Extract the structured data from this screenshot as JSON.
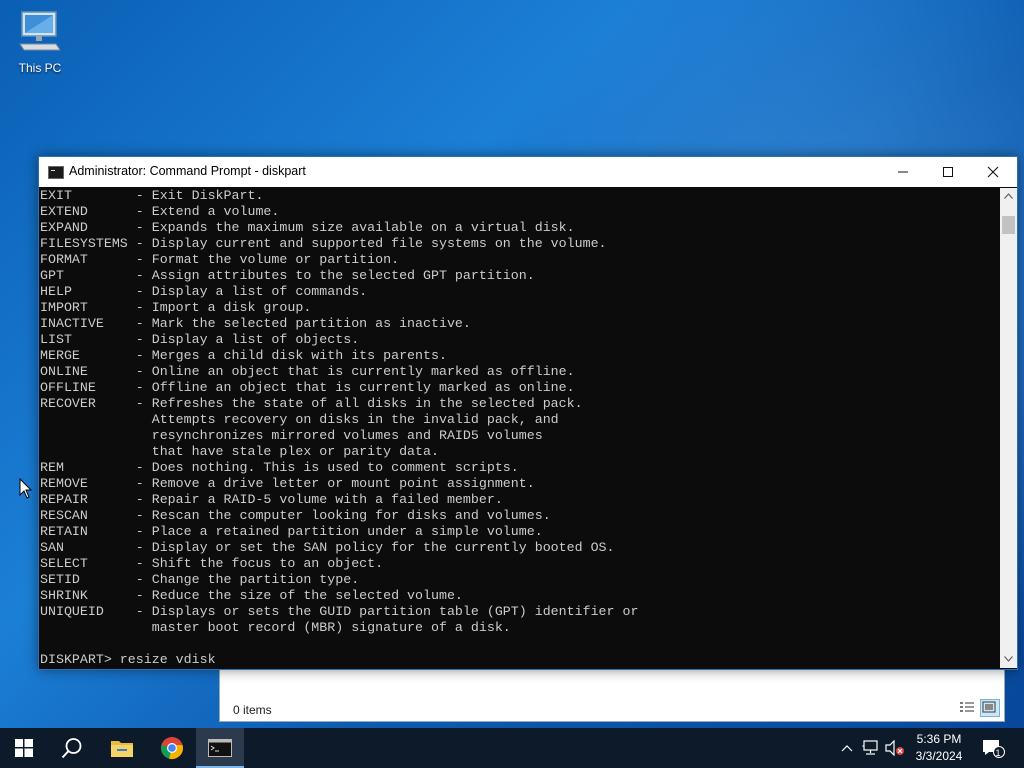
{
  "desktop": {
    "icons": [
      {
        "label": "This PC",
        "icon": "computer-icon"
      }
    ]
  },
  "explorer": {
    "status": "0 items"
  },
  "cmd_window": {
    "title": "Administrator: Command Prompt - diskpart",
    "controls": [
      "minimize",
      "maximize",
      "close"
    ],
    "lines": [
      "EXIT        - Exit DiskPart.",
      "EXTEND      - Extend a volume.",
      "EXPAND      - Expands the maximum size available on a virtual disk.",
      "FILESYSTEMS - Display current and supported file systems on the volume.",
      "FORMAT      - Format the volume or partition.",
      "GPT         - Assign attributes to the selected GPT partition.",
      "HELP        - Display a list of commands.",
      "IMPORT      - Import a disk group.",
      "INACTIVE    - Mark the selected partition as inactive.",
      "LIST        - Display a list of objects.",
      "MERGE       - Merges a child disk with its parents.",
      "ONLINE      - Online an object that is currently marked as offline.",
      "OFFLINE     - Offline an object that is currently marked as online.",
      "RECOVER     - Refreshes the state of all disks in the selected pack.",
      "              Attempts recovery on disks in the invalid pack, and",
      "              resynchronizes mirrored volumes and RAID5 volumes",
      "              that have stale plex or parity data.",
      "REM         - Does nothing. This is used to comment scripts.",
      "REMOVE      - Remove a drive letter or mount point assignment.",
      "REPAIR      - Repair a RAID-5 volume with a failed member.",
      "RESCAN      - Rescan the computer looking for disks and volumes.",
      "RETAIN      - Place a retained partition under a simple volume.",
      "SAN         - Display or set the SAN policy for the currently booted OS.",
      "SELECT      - Shift the focus to an object.",
      "SETID       - Change the partition type.",
      "SHRINK      - Reduce the size of the selected volume.",
      "UNIQUEID    - Displays or sets the GUID partition table (GPT) identifier or",
      "              master boot record (MBR) signature of a disk.",
      "",
      "DISKPART> resize vdisk"
    ]
  },
  "taskbar": {
    "pinned": [
      {
        "name": "start",
        "icon": "windows-logo-icon"
      },
      {
        "name": "search",
        "icon": "search-icon"
      },
      {
        "name": "file-explorer",
        "icon": "folder-icon"
      },
      {
        "name": "chrome",
        "icon": "chrome-icon"
      },
      {
        "name": "command-prompt",
        "icon": "terminal-icon",
        "active": true
      }
    ],
    "clock": {
      "time": "5:36 PM",
      "date": "3/3/2024"
    },
    "notification_count": "1"
  }
}
